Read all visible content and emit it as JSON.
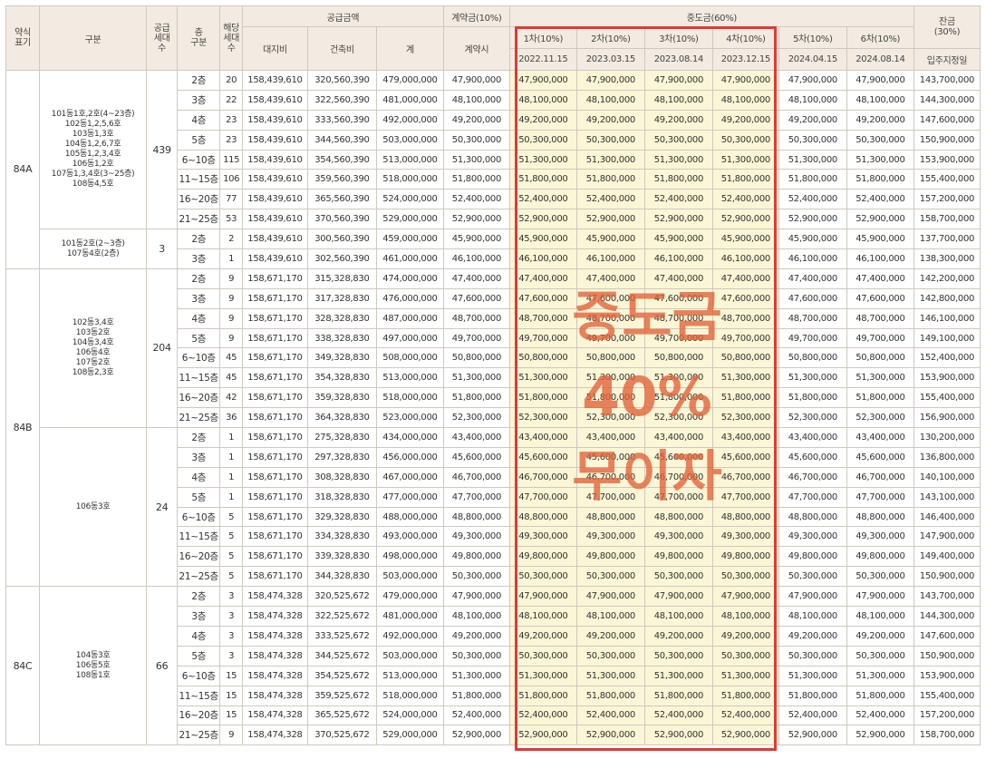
{
  "header": {
    "type": "약식\n표기",
    "group": "구분",
    "supply": "공급\n세대\n수",
    "floor": "층\n구분",
    "units": "해당\n세대\n수",
    "price": "공급금액",
    "land": "대지비",
    "build": "건축비",
    "total": "계",
    "deposit": "계약금(10%)",
    "deposit_sub": "계약시",
    "middle": "중도금(60%)",
    "balance": "잔금\n(30%)",
    "balance_sub": "입주지정일",
    "installments": [
      {
        "label": "1차(10%)",
        "date": "2022.11.15"
      },
      {
        "label": "2차(10%)",
        "date": "2023.03.15"
      },
      {
        "label": "3차(10%)",
        "date": "2023.08.14"
      },
      {
        "label": "4차(10%)",
        "date": "2023.12.15"
      },
      {
        "label": "5차(10%)",
        "date": "2024.04.15"
      },
      {
        "label": "6차(10%)",
        "date": "2024.08.14"
      }
    ]
  },
  "overlay": {
    "line1": "중도금",
    "line2": "40%",
    "line3": "무이자"
  },
  "groups": [
    {
      "type": "84A",
      "blocks": [
        {
          "dong": "101동1호,2호(4~23층)\n102동1,2,5,6호\n103동1,3호\n104동1,2,6,7호\n105동1,2,3,4호\n106동1,2호\n107동1,3,4호(3~25층)\n108동4,5호",
          "supply": "439",
          "rows": [
            [
              "2층",
              "20",
              "158,439,610",
              "320,560,390",
              "479,000,000",
              "47,900,000",
              "47,900,000",
              "47,900,000",
              "47,900,000",
              "47,900,000",
              "47,900,000",
              "47,900,000",
              "143,700,000"
            ],
            [
              "3층",
              "22",
              "158,439,610",
              "322,560,390",
              "481,000,000",
              "48,100,000",
              "48,100,000",
              "48,100,000",
              "48,100,000",
              "48,100,000",
              "48,100,000",
              "48,100,000",
              "144,300,000"
            ],
            [
              "4층",
              "23",
              "158,439,610",
              "333,560,390",
              "492,000,000",
              "49,200,000",
              "49,200,000",
              "49,200,000",
              "49,200,000",
              "49,200,000",
              "49,200,000",
              "49,200,000",
              "147,600,000"
            ],
            [
              "5층",
              "23",
              "158,439,610",
              "344,560,390",
              "503,000,000",
              "50,300,000",
              "50,300,000",
              "50,300,000",
              "50,300,000",
              "50,300,000",
              "50,300,000",
              "50,300,000",
              "150,900,000"
            ],
            [
              "6~10층",
              "115",
              "158,439,610",
              "354,560,390",
              "513,000,000",
              "51,300,000",
              "51,300,000",
              "51,300,000",
              "51,300,000",
              "51,300,000",
              "51,300,000",
              "51,300,000",
              "153,900,000"
            ],
            [
              "11~15층",
              "106",
              "158,439,610",
              "359,560,390",
              "518,000,000",
              "51,800,000",
              "51,800,000",
              "51,800,000",
              "51,800,000",
              "51,800,000",
              "51,800,000",
              "51,800,000",
              "155,400,000"
            ],
            [
              "16~20층",
              "77",
              "158,439,610",
              "365,560,390",
              "524,000,000",
              "52,400,000",
              "52,400,000",
              "52,400,000",
              "52,400,000",
              "52,400,000",
              "52,400,000",
              "52,400,000",
              "157,200,000"
            ],
            [
              "21~25층",
              "53",
              "158,439,610",
              "370,560,390",
              "529,000,000",
              "52,900,000",
              "52,900,000",
              "52,900,000",
              "52,900,000",
              "52,900,000",
              "52,900,000",
              "52,900,000",
              "158,700,000"
            ]
          ]
        },
        {
          "dong": "101동2호(2~3층)\n107동4호(2층)",
          "supply": "3",
          "rows": [
            [
              "2층",
              "2",
              "158,439,610",
              "300,560,390",
              "459,000,000",
              "45,900,000",
              "45,900,000",
              "45,900,000",
              "45,900,000",
              "45,900,000",
              "45,900,000",
              "45,900,000",
              "137,700,000"
            ],
            [
              "3층",
              "1",
              "158,439,610",
              "302,560,390",
              "461,000,000",
              "46,100,000",
              "46,100,000",
              "46,100,000",
              "46,100,000",
              "46,100,000",
              "46,100,000",
              "46,100,000",
              "138,300,000"
            ]
          ]
        }
      ]
    },
    {
      "type": "84B",
      "blocks": [
        {
          "dong": "102동3,4호\n103동2호\n104동3,4호\n106동4호\n107동2호\n108동2,3호",
          "supply": "204",
          "rows": [
            [
              "2층",
              "9",
              "158,671,170",
              "315,328,830",
              "474,000,000",
              "47,400,000",
              "47,400,000",
              "47,400,000",
              "47,400,000",
              "47,400,000",
              "47,400,000",
              "47,400,000",
              "142,200,000"
            ],
            [
              "3층",
              "9",
              "158,671,170",
              "317,328,830",
              "476,000,000",
              "47,600,000",
              "47,600,000",
              "47,600,000",
              "47,600,000",
              "47,600,000",
              "47,600,000",
              "47,600,000",
              "142,800,000"
            ],
            [
              "4층",
              "9",
              "158,671,170",
              "328,328,830",
              "487,000,000",
              "48,700,000",
              "48,700,000",
              "48,700,000",
              "48,700,000",
              "48,700,000",
              "48,700,000",
              "48,700,000",
              "146,100,000"
            ],
            [
              "5층",
              "9",
              "158,671,170",
              "338,328,830",
              "497,000,000",
              "49,700,000",
              "49,700,000",
              "49,700,000",
              "49,700,000",
              "49,700,000",
              "49,700,000",
              "49,700,000",
              "149,100,000"
            ],
            [
              "6~10층",
              "45",
              "158,671,170",
              "349,328,830",
              "508,000,000",
              "50,800,000",
              "50,800,000",
              "50,800,000",
              "50,800,000",
              "50,800,000",
              "50,800,000",
              "50,800,000",
              "152,400,000"
            ],
            [
              "11~15층",
              "45",
              "158,671,170",
              "354,328,830",
              "513,000,000",
              "51,300,000",
              "51,300,000",
              "51,300,000",
              "51,300,000",
              "51,300,000",
              "51,300,000",
              "51,300,000",
              "153,900,000"
            ],
            [
              "16~20층",
              "42",
              "158,671,170",
              "359,328,830",
              "518,000,000",
              "51,800,000",
              "51,800,000",
              "51,800,000",
              "51,800,000",
              "51,800,000",
              "51,800,000",
              "51,800,000",
              "155,400,000"
            ],
            [
              "21~25층",
              "36",
              "158,671,170",
              "364,328,830",
              "523,000,000",
              "52,300,000",
              "52,300,000",
              "52,300,000",
              "52,300,000",
              "52,300,000",
              "52,300,000",
              "52,300,000",
              "156,900,000"
            ]
          ]
        },
        {
          "dong": "106동3호",
          "supply": "24",
          "rows": [
            [
              "2층",
              "1",
              "158,671,170",
              "275,328,830",
              "434,000,000",
              "43,400,000",
              "43,400,000",
              "43,400,000",
              "43,400,000",
              "43,400,000",
              "43,400,000",
              "43,400,000",
              "130,200,000"
            ],
            [
              "3층",
              "1",
              "158,671,170",
              "297,328,830",
              "456,000,000",
              "45,600,000",
              "45,600,000",
              "45,600,000",
              "45,600,000",
              "45,600,000",
              "45,600,000",
              "45,600,000",
              "136,800,000"
            ],
            [
              "4층",
              "1",
              "158,671,170",
              "308,328,830",
              "467,000,000",
              "46,700,000",
              "46,700,000",
              "46,700,000",
              "46,700,000",
              "46,700,000",
              "46,700,000",
              "46,700,000",
              "140,100,000"
            ],
            [
              "5층",
              "1",
              "158,671,170",
              "318,328,830",
              "477,000,000",
              "47,700,000",
              "47,700,000",
              "47,700,000",
              "47,700,000",
              "47,700,000",
              "47,700,000",
              "47,700,000",
              "143,100,000"
            ],
            [
              "6~10층",
              "5",
              "158,671,170",
              "329,328,830",
              "488,000,000",
              "48,800,000",
              "48,800,000",
              "48,800,000",
              "48,800,000",
              "48,800,000",
              "48,800,000",
              "48,800,000",
              "146,400,000"
            ],
            [
              "11~15층",
              "5",
              "158,671,170",
              "334,328,830",
              "493,000,000",
              "49,300,000",
              "49,300,000",
              "49,300,000",
              "49,300,000",
              "49,300,000",
              "49,300,000",
              "49,300,000",
              "147,900,000"
            ],
            [
              "16~20층",
              "5",
              "158,671,170",
              "339,328,830",
              "498,000,000",
              "49,800,000",
              "49,800,000",
              "49,800,000",
              "49,800,000",
              "49,800,000",
              "49,800,000",
              "49,800,000",
              "149,400,000"
            ],
            [
              "21~25층",
              "5",
              "158,671,170",
              "344,328,830",
              "503,000,000",
              "50,300,000",
              "50,300,000",
              "50,300,000",
              "50,300,000",
              "50,300,000",
              "50,300,000",
              "50,300,000",
              "150,900,000"
            ]
          ]
        }
      ]
    },
    {
      "type": "84C",
      "blocks": [
        {
          "dong": "104동3호\n106동5호\n108동1호",
          "supply": "66",
          "rows": [
            [
              "2층",
              "3",
              "158,474,328",
              "320,525,672",
              "479,000,000",
              "47,900,000",
              "47,900,000",
              "47,900,000",
              "47,900,000",
              "47,900,000",
              "47,900,000",
              "47,900,000",
              "143,700,000"
            ],
            [
              "3층",
              "3",
              "158,474,328",
              "322,525,672",
              "481,000,000",
              "48,100,000",
              "48,100,000",
              "48,100,000",
              "48,100,000",
              "48,100,000",
              "48,100,000",
              "48,100,000",
              "144,300,000"
            ],
            [
              "4층",
              "3",
              "158,474,328",
              "333,525,672",
              "492,000,000",
              "49,200,000",
              "49,200,000",
              "49,200,000",
              "49,200,000",
              "49,200,000",
              "49,200,000",
              "49,200,000",
              "147,600,000"
            ],
            [
              "5층",
              "3",
              "158,474,328",
              "344,525,672",
              "503,000,000",
              "50,300,000",
              "50,300,000",
              "50,300,000",
              "50,300,000",
              "50,300,000",
              "50,300,000",
              "50,300,000",
              "150,900,000"
            ],
            [
              "6~10층",
              "15",
              "158,474,328",
              "354,525,672",
              "513,000,000",
              "51,300,000",
              "51,300,000",
              "51,300,000",
              "51,300,000",
              "51,300,000",
              "51,300,000",
              "51,300,000",
              "153,900,000"
            ],
            [
              "11~15층",
              "15",
              "158,474,328",
              "359,525,672",
              "518,000,000",
              "51,800,000",
              "51,800,000",
              "51,800,000",
              "51,800,000",
              "51,800,000",
              "51,800,000",
              "51,800,000",
              "155,400,000"
            ],
            [
              "16~20층",
              "15",
              "158,474,328",
              "365,525,672",
              "524,000,000",
              "52,400,000",
              "52,400,000",
              "52,400,000",
              "52,400,000",
              "52,400,000",
              "52,400,000",
              "52,400,000",
              "157,200,000"
            ],
            [
              "21~25층",
              "9",
              "158,474,328",
              "370,525,672",
              "529,000,000",
              "52,900,000",
              "52,900,000",
              "52,900,000",
              "52,900,000",
              "52,900,000",
              "52,900,000",
              "52,900,000",
              "158,700,000"
            ]
          ]
        }
      ]
    }
  ]
}
